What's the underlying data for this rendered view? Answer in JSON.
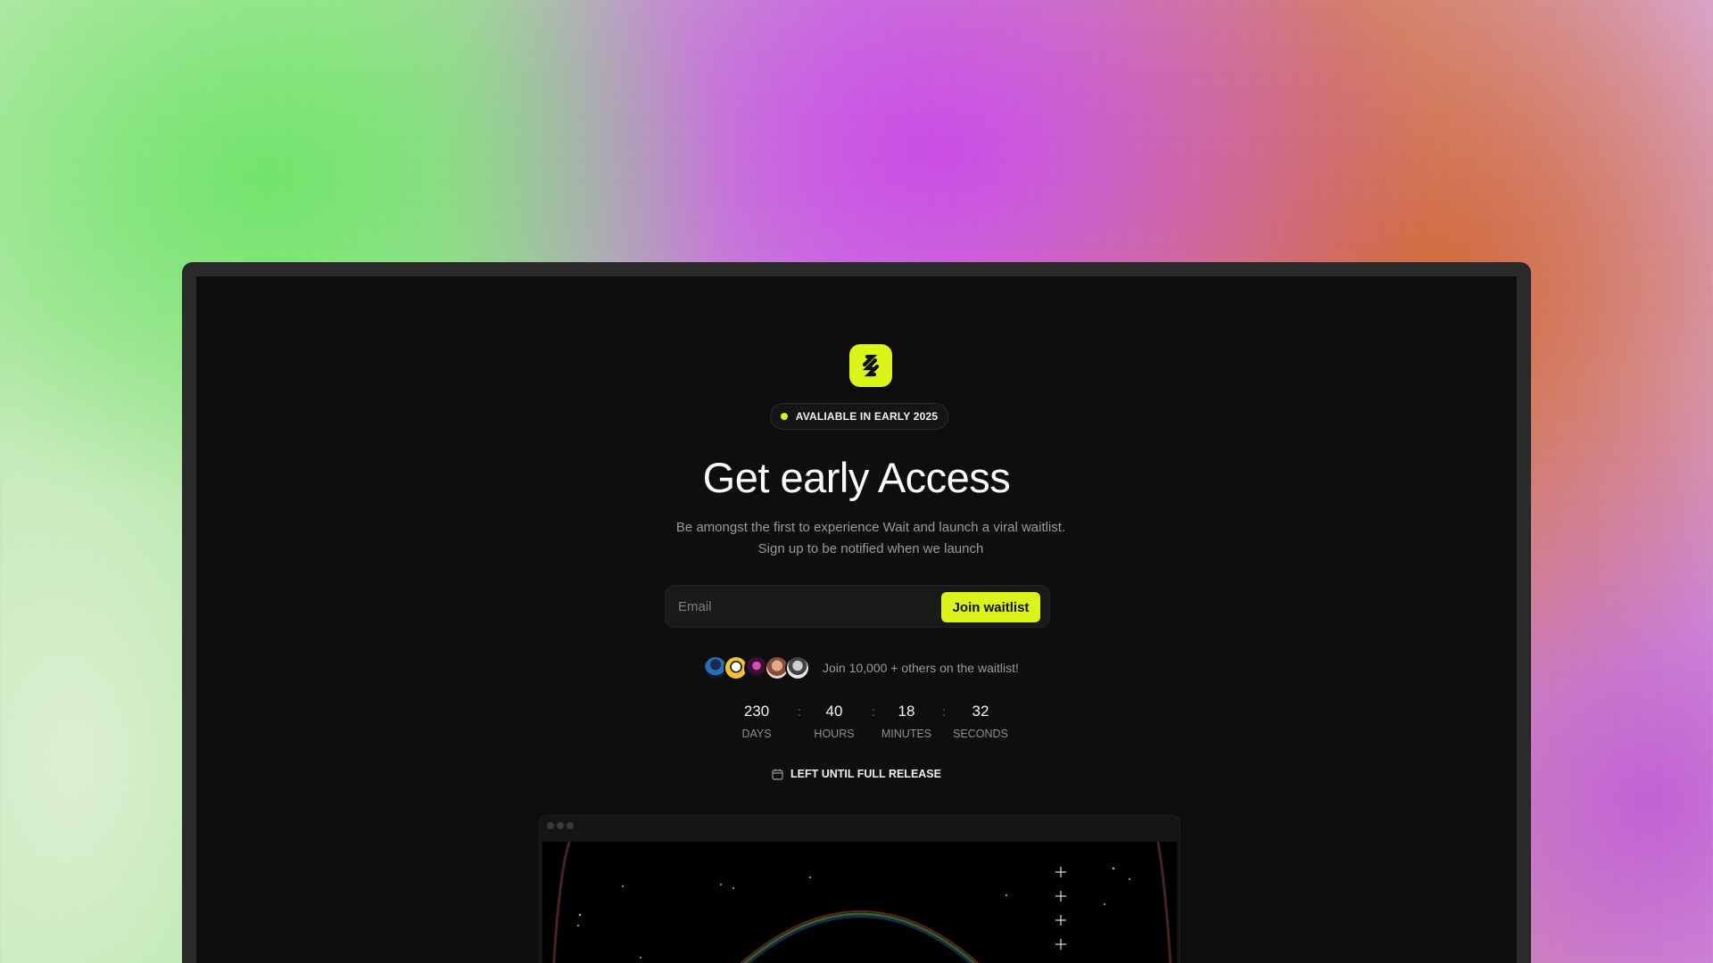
{
  "hero": {
    "badge_text": "AVALIABLE IN EARLY 2025",
    "title": "Get early Access",
    "subtitle": "Be amongst the first to experience Wait and launch a viral waitlist. Sign up to be notified when we launch"
  },
  "form": {
    "email_placeholder": "Email",
    "email_value": "",
    "submit_label": "Join waitlist"
  },
  "social_proof": {
    "text": "Join 10,000 + others on the waitlist!",
    "avatar_count": 5
  },
  "countdown": {
    "days": {
      "value": "230",
      "label": "DAYS"
    },
    "hours": {
      "value": "40",
      "label": "HOURS"
    },
    "minutes": {
      "value": "18",
      "label": "MINUTES"
    },
    "seconds": {
      "value": "32",
      "label": "SECONDS"
    },
    "separator": ":"
  },
  "release_text": "LEFT UNTIL FULL RELEASE",
  "icons": {
    "logo": "brand-logo-icon",
    "badge_dot": "status-dot-icon",
    "calendar": "calendar-icon",
    "window_controls": "window-dots-icon"
  },
  "colors": {
    "accent": "#d9f51a",
    "page_background": "#0e0e0e",
    "device_frame": "#2a2a2a",
    "muted_text": "#9a9a9a"
  }
}
